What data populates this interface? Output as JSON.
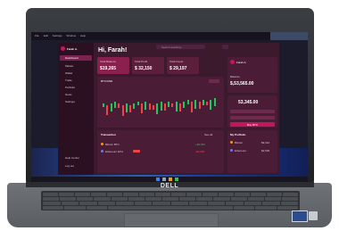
{
  "laptop": {
    "brand": "DELL"
  },
  "menubar": {
    "items": [
      "File",
      "Edit",
      "Settings",
      "Window",
      "Help"
    ]
  },
  "search": {
    "placeholder": "Search anything..."
  },
  "sidebar": {
    "user_name": "Farah A.",
    "items": [
      "Dashboard",
      "Market",
      "Wallet",
      "Trade",
      "Portfolio",
      "News",
      "Settings"
    ],
    "bottom_items": [
      "Help Center",
      "Log out"
    ]
  },
  "header": {
    "greeting": "Hi, Farah!"
  },
  "stats": [
    {
      "label": "Total Balance",
      "value": "$19,265"
    },
    {
      "label": "Total Profit",
      "value": "$ 32,150"
    },
    {
      "label": "Total Invest",
      "value": "$ 29,197"
    }
  ],
  "chart": {
    "pair": "BTC/USD"
  },
  "transactions": {
    "title": "Transaction",
    "action": "See all",
    "rows": [
      {
        "name": "Bitcoin BTC",
        "amount": "+$5,553"
      },
      {
        "name": "Ethereum ETH",
        "amount": "-$2,350"
      }
    ]
  },
  "profile": {
    "name": "Farah A.",
    "balance_label": "Balance",
    "balance": "$,53,565.00",
    "second_value": "53,345.00",
    "buy_label": "Buy BTC"
  },
  "portfolio": {
    "title": "My Portfolio",
    "items": [
      {
        "name": "Bitcoin",
        "value": "$9,310"
      },
      {
        "name": "Ethereum",
        "value": "$2,530"
      }
    ]
  },
  "colors": {
    "accent": "#c2185b",
    "panel": "#3b1a2e",
    "sidebar": "#2a1020",
    "up": "#22c55e",
    "down": "#ef4444"
  },
  "chart_data": {
    "type": "table",
    "candles": [
      {
        "dir": "up"
      },
      {
        "dir": "down"
      },
      {
        "dir": "up"
      },
      {
        "dir": "up"
      },
      {
        "dir": "down"
      },
      {
        "dir": "down"
      },
      {
        "dir": "up"
      },
      {
        "dir": "down"
      },
      {
        "dir": "up"
      },
      {
        "dir": "up"
      },
      {
        "dir": "down"
      },
      {
        "dir": "up"
      },
      {
        "dir": "down"
      },
      {
        "dir": "down"
      },
      {
        "dir": "up"
      },
      {
        "dir": "up"
      },
      {
        "dir": "down"
      },
      {
        "dir": "up"
      },
      {
        "dir": "down"
      },
      {
        "dir": "up"
      },
      {
        "dir": "down"
      },
      {
        "dir": "up"
      },
      {
        "dir": "up"
      },
      {
        "dir": "down"
      },
      {
        "dir": "up"
      },
      {
        "dir": "down"
      },
      {
        "dir": "up"
      },
      {
        "dir": "down"
      },
      {
        "dir": "up"
      },
      {
        "dir": "up"
      }
    ]
  }
}
